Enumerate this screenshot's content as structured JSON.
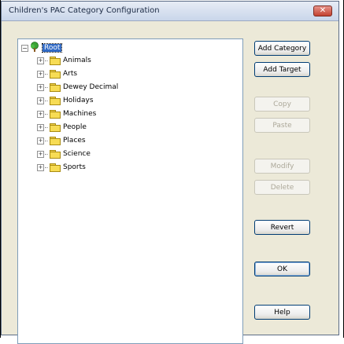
{
  "window": {
    "title": "Children's PAC Category Configuration",
    "close_glyph": "✕"
  },
  "tree": {
    "root": {
      "label": "Root",
      "icon": "tree-icon",
      "expander": "⊟"
    },
    "items": [
      {
        "label": "Animals",
        "expander": "+"
      },
      {
        "label": "Arts",
        "expander": "+"
      },
      {
        "label": "Dewey Decimal",
        "expander": "+"
      },
      {
        "label": "Holidays",
        "expander": "+"
      },
      {
        "label": "Machines",
        "expander": "+"
      },
      {
        "label": "People",
        "expander": "+"
      },
      {
        "label": "Places",
        "expander": "+"
      },
      {
        "label": "Science",
        "expander": "+"
      },
      {
        "label": "Sports",
        "expander": "+"
      }
    ]
  },
  "buttons": {
    "add_category": "Add Category",
    "add_target": "Add Target",
    "copy": "Copy",
    "paste": "Paste",
    "modify": "Modify",
    "delete": "Delete",
    "revert": "Revert",
    "ok": "OK",
    "help": "Help"
  },
  "colors": {
    "selection": "#316ac5",
    "folder": "#f7dc54",
    "button_border": "#003c74",
    "disabled_text": "#aca899"
  }
}
